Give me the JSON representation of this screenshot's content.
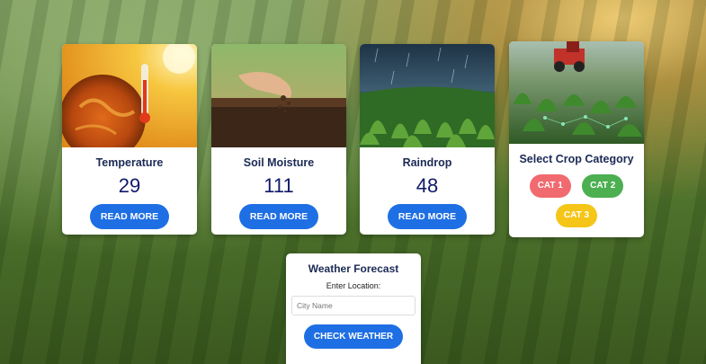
{
  "cards": [
    {
      "title": "Temperature",
      "value": "29",
      "button": "READ MORE"
    },
    {
      "title": "Soil Moisture",
      "value": "111",
      "button": "READ MORE"
    },
    {
      "title": "Raindrop",
      "value": "48",
      "button": "READ MORE"
    }
  ],
  "crop": {
    "title": "Select Crop Category",
    "categories": [
      {
        "label": "CAT 1",
        "color": "#f06a6f"
      },
      {
        "label": "CAT 2",
        "color": "#4caf50"
      },
      {
        "label": "CAT 3",
        "color": "#f5c518"
      }
    ]
  },
  "weather": {
    "title": "Weather Forecast",
    "location_label": "Enter Location:",
    "placeholder": "City Name",
    "button": "CHECK WEATHER"
  },
  "colors": {
    "button": "#1f6fe4",
    "title": "#1b2a55",
    "value": "#10196a"
  }
}
